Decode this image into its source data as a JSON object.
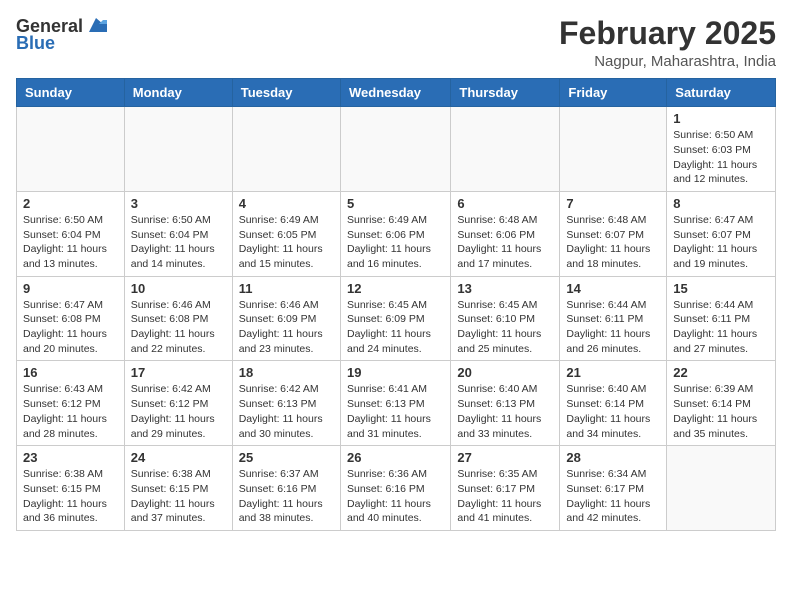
{
  "header": {
    "logo_general": "General",
    "logo_blue": "Blue",
    "month_year": "February 2025",
    "location": "Nagpur, Maharashtra, India"
  },
  "weekdays": [
    "Sunday",
    "Monday",
    "Tuesday",
    "Wednesday",
    "Thursday",
    "Friday",
    "Saturday"
  ],
  "weeks": [
    [
      {
        "day": "",
        "info": ""
      },
      {
        "day": "",
        "info": ""
      },
      {
        "day": "",
        "info": ""
      },
      {
        "day": "",
        "info": ""
      },
      {
        "day": "",
        "info": ""
      },
      {
        "day": "",
        "info": ""
      },
      {
        "day": "1",
        "info": "Sunrise: 6:50 AM\nSunset: 6:03 PM\nDaylight: 11 hours\nand 12 minutes."
      }
    ],
    [
      {
        "day": "2",
        "info": "Sunrise: 6:50 AM\nSunset: 6:04 PM\nDaylight: 11 hours\nand 13 minutes."
      },
      {
        "day": "3",
        "info": "Sunrise: 6:50 AM\nSunset: 6:04 PM\nDaylight: 11 hours\nand 14 minutes."
      },
      {
        "day": "4",
        "info": "Sunrise: 6:49 AM\nSunset: 6:05 PM\nDaylight: 11 hours\nand 15 minutes."
      },
      {
        "day": "5",
        "info": "Sunrise: 6:49 AM\nSunset: 6:06 PM\nDaylight: 11 hours\nand 16 minutes."
      },
      {
        "day": "6",
        "info": "Sunrise: 6:48 AM\nSunset: 6:06 PM\nDaylight: 11 hours\nand 17 minutes."
      },
      {
        "day": "7",
        "info": "Sunrise: 6:48 AM\nSunset: 6:07 PM\nDaylight: 11 hours\nand 18 minutes."
      },
      {
        "day": "8",
        "info": "Sunrise: 6:47 AM\nSunset: 6:07 PM\nDaylight: 11 hours\nand 19 minutes."
      }
    ],
    [
      {
        "day": "9",
        "info": "Sunrise: 6:47 AM\nSunset: 6:08 PM\nDaylight: 11 hours\nand 20 minutes."
      },
      {
        "day": "10",
        "info": "Sunrise: 6:46 AM\nSunset: 6:08 PM\nDaylight: 11 hours\nand 22 minutes."
      },
      {
        "day": "11",
        "info": "Sunrise: 6:46 AM\nSunset: 6:09 PM\nDaylight: 11 hours\nand 23 minutes."
      },
      {
        "day": "12",
        "info": "Sunrise: 6:45 AM\nSunset: 6:09 PM\nDaylight: 11 hours\nand 24 minutes."
      },
      {
        "day": "13",
        "info": "Sunrise: 6:45 AM\nSunset: 6:10 PM\nDaylight: 11 hours\nand 25 minutes."
      },
      {
        "day": "14",
        "info": "Sunrise: 6:44 AM\nSunset: 6:11 PM\nDaylight: 11 hours\nand 26 minutes."
      },
      {
        "day": "15",
        "info": "Sunrise: 6:44 AM\nSunset: 6:11 PM\nDaylight: 11 hours\nand 27 minutes."
      }
    ],
    [
      {
        "day": "16",
        "info": "Sunrise: 6:43 AM\nSunset: 6:12 PM\nDaylight: 11 hours\nand 28 minutes."
      },
      {
        "day": "17",
        "info": "Sunrise: 6:42 AM\nSunset: 6:12 PM\nDaylight: 11 hours\nand 29 minutes."
      },
      {
        "day": "18",
        "info": "Sunrise: 6:42 AM\nSunset: 6:13 PM\nDaylight: 11 hours\nand 30 minutes."
      },
      {
        "day": "19",
        "info": "Sunrise: 6:41 AM\nSunset: 6:13 PM\nDaylight: 11 hours\nand 31 minutes."
      },
      {
        "day": "20",
        "info": "Sunrise: 6:40 AM\nSunset: 6:13 PM\nDaylight: 11 hours\nand 33 minutes."
      },
      {
        "day": "21",
        "info": "Sunrise: 6:40 AM\nSunset: 6:14 PM\nDaylight: 11 hours\nand 34 minutes."
      },
      {
        "day": "22",
        "info": "Sunrise: 6:39 AM\nSunset: 6:14 PM\nDaylight: 11 hours\nand 35 minutes."
      }
    ],
    [
      {
        "day": "23",
        "info": "Sunrise: 6:38 AM\nSunset: 6:15 PM\nDaylight: 11 hours\nand 36 minutes."
      },
      {
        "day": "24",
        "info": "Sunrise: 6:38 AM\nSunset: 6:15 PM\nDaylight: 11 hours\nand 37 minutes."
      },
      {
        "day": "25",
        "info": "Sunrise: 6:37 AM\nSunset: 6:16 PM\nDaylight: 11 hours\nand 38 minutes."
      },
      {
        "day": "26",
        "info": "Sunrise: 6:36 AM\nSunset: 6:16 PM\nDaylight: 11 hours\nand 40 minutes."
      },
      {
        "day": "27",
        "info": "Sunrise: 6:35 AM\nSunset: 6:17 PM\nDaylight: 11 hours\nand 41 minutes."
      },
      {
        "day": "28",
        "info": "Sunrise: 6:34 AM\nSunset: 6:17 PM\nDaylight: 11 hours\nand 42 minutes."
      },
      {
        "day": "",
        "info": ""
      }
    ]
  ]
}
